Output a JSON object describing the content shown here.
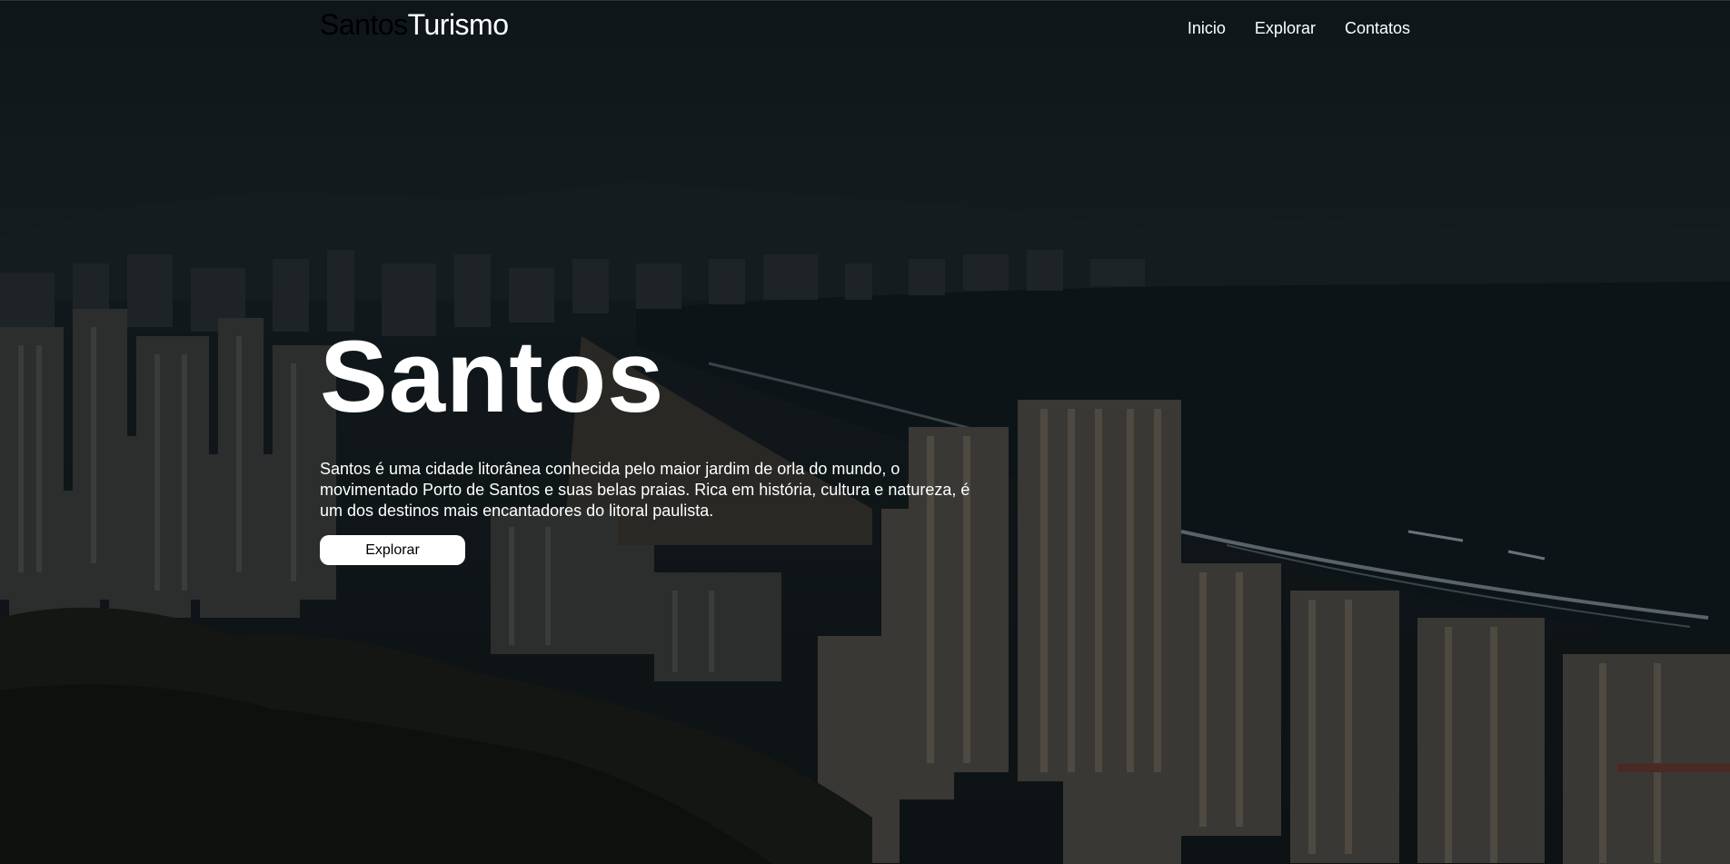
{
  "header": {
    "logo_part1": "Santos",
    "logo_part2": "Turismo",
    "nav": [
      {
        "label": "Inicio"
      },
      {
        "label": "Explorar"
      },
      {
        "label": "Contatos"
      }
    ]
  },
  "hero": {
    "title": "Santos",
    "description": "Santos é uma cidade litorânea conhecida pelo maior jardim de orla do mundo, o movimentado Porto de Santos e suas belas praias. Rica em história, cultura e natureza, é um dos destinos mais encantadores do litoral paulista.",
    "button_label": "Explorar"
  },
  "colors": {
    "overlay": "#0b1114",
    "text": "#ffffff",
    "button_bg": "#ffffff",
    "button_text": "#000000"
  }
}
